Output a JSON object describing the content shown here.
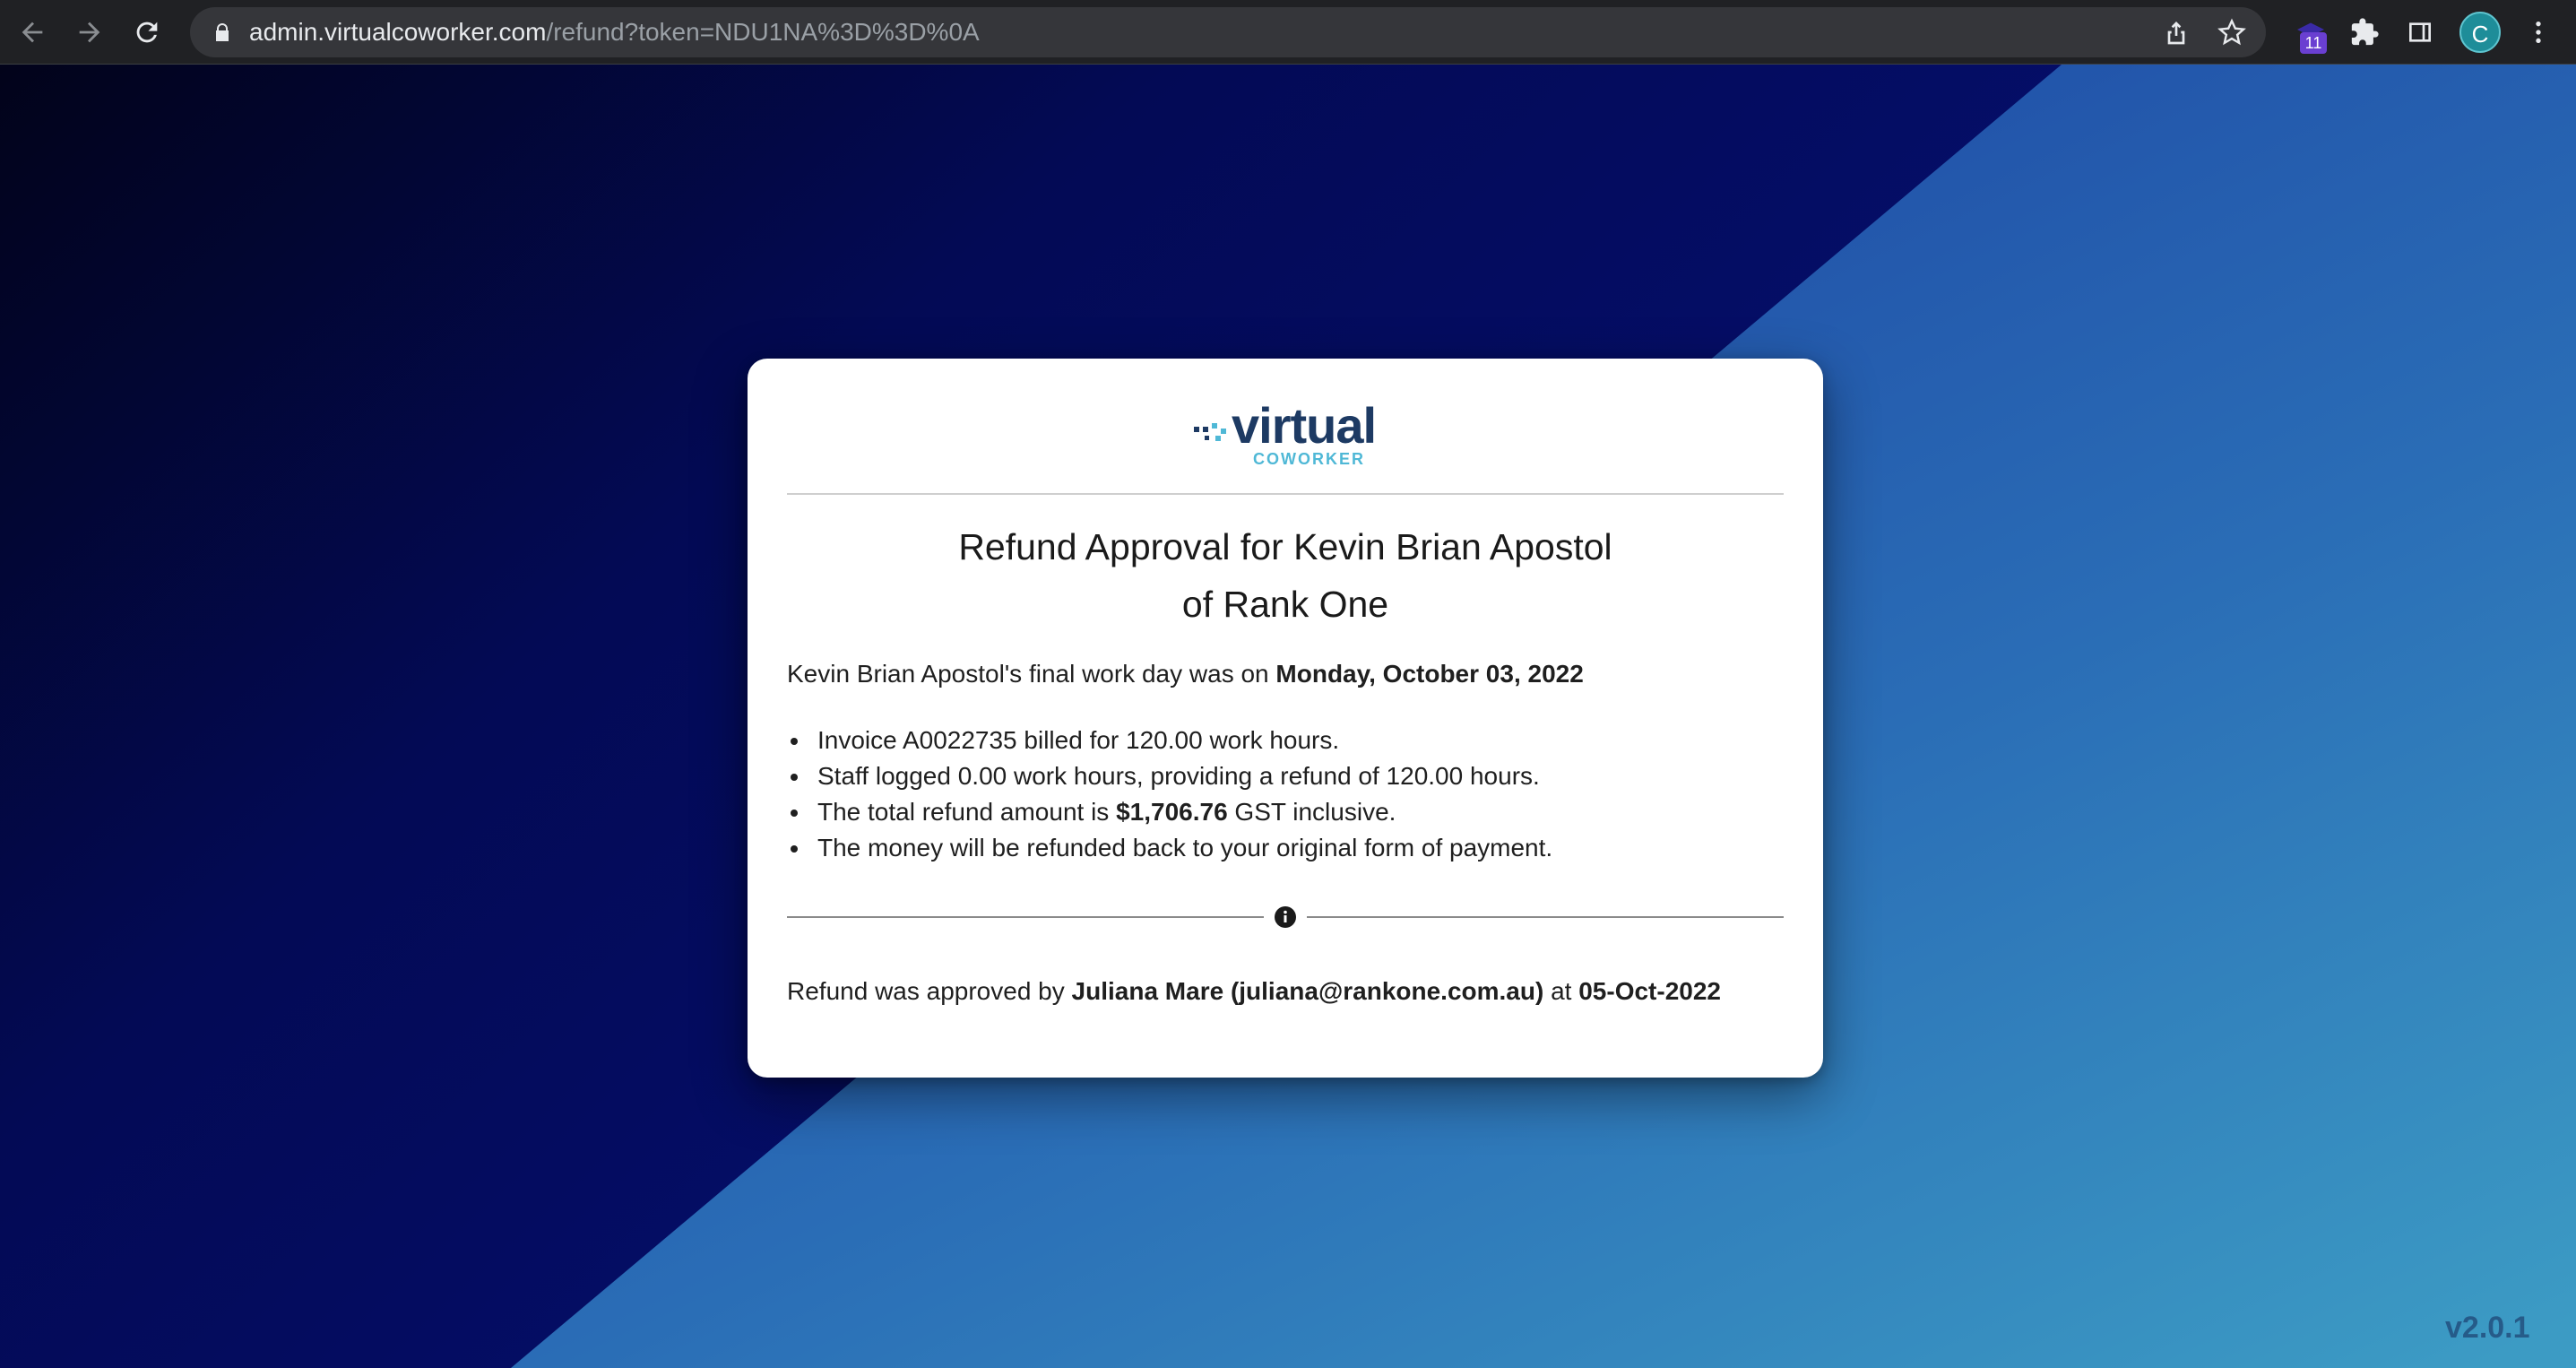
{
  "browser": {
    "url_host": "admin.virtualcoworker.com",
    "url_path": "/refund?token=NDU1NA%3D%3D%0A",
    "extension_badge": "11",
    "profile_initial": "C",
    "icons": [
      "back-icon",
      "forward-icon",
      "reload-icon",
      "lock-icon",
      "share-icon",
      "star-icon",
      "extension-icon",
      "puzzle-icon",
      "side-panel-icon",
      "kebab-menu-icon"
    ]
  },
  "logo": {
    "main": "virtual",
    "sub": "COWORKER"
  },
  "card": {
    "title_line1": "Refund Approval for Kevin Brian Apostol",
    "title_line2": "of Rank One",
    "final_day_prefix": "Kevin Brian Apostol's final work day was on ",
    "final_day_date": "Monday, October 03, 2022",
    "bullets": {
      "invoice": "Invoice A0022735 billed for 120.00 work hours.",
      "staff_logged": "Staff logged 0.00 work hours, providing a refund of 120.00 hours.",
      "total_prefix": "The total refund amount is ",
      "total_amount": "$1,706.76",
      "total_suffix": " GST inclusive.",
      "money_back": "The money will be refunded back to your original form of payment."
    },
    "approval_prefix": "Refund was approved by ",
    "approver": "Juliana Mare (juliana@rankone.com.au)",
    "approval_mid": " at ",
    "approval_date": "05-Oct-2022"
  },
  "version": "v2.0.1",
  "colors": {
    "bg_dark": "#02031a",
    "bg_navy": "#06107a",
    "bg_blue": "#1f4fa8",
    "bg_teal": "#3d98c4",
    "logo_navy": "#1d3a63",
    "logo_teal": "#4fb8d6"
  }
}
